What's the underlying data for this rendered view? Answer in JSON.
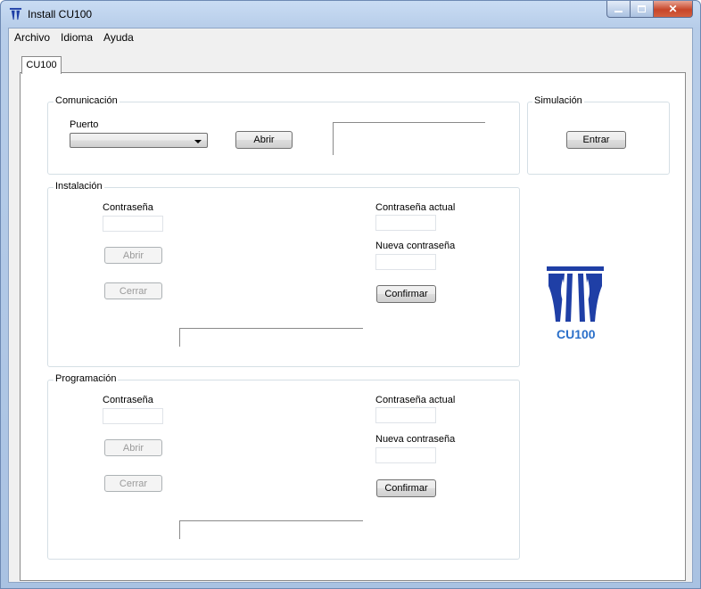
{
  "window": {
    "title": "Install CU100"
  },
  "menu": {
    "items": [
      "Archivo",
      "Idioma",
      "Ayuda"
    ]
  },
  "tab": {
    "label": "CU100"
  },
  "comunicacion": {
    "title": "Comunicación",
    "puerto_label": "Puerto",
    "puerto_value": "",
    "abrir_label": "Abrir"
  },
  "simulacion": {
    "title": "Simulación",
    "entrar_label": "Entrar"
  },
  "instalacion": {
    "title": "Instalación",
    "contrasena_label": "Contraseña",
    "abrir_label": "Abrir",
    "cerrar_label": "Cerrar",
    "actual_label": "Contraseña actual",
    "nueva_label": "Nueva contraseña",
    "confirmar_label": "Confirmar"
  },
  "programacion": {
    "title": "Programación",
    "contrasena_label": "Contraseña",
    "abrir_label": "Abrir",
    "cerrar_label": "Cerrar",
    "actual_label": "Contraseña actual",
    "nueva_label": "Nueva contraseña",
    "confirmar_label": "Confirmar"
  },
  "logo": {
    "text": "CU100",
    "color": "#1f3fa6",
    "text_color": "#2a6fc9"
  }
}
